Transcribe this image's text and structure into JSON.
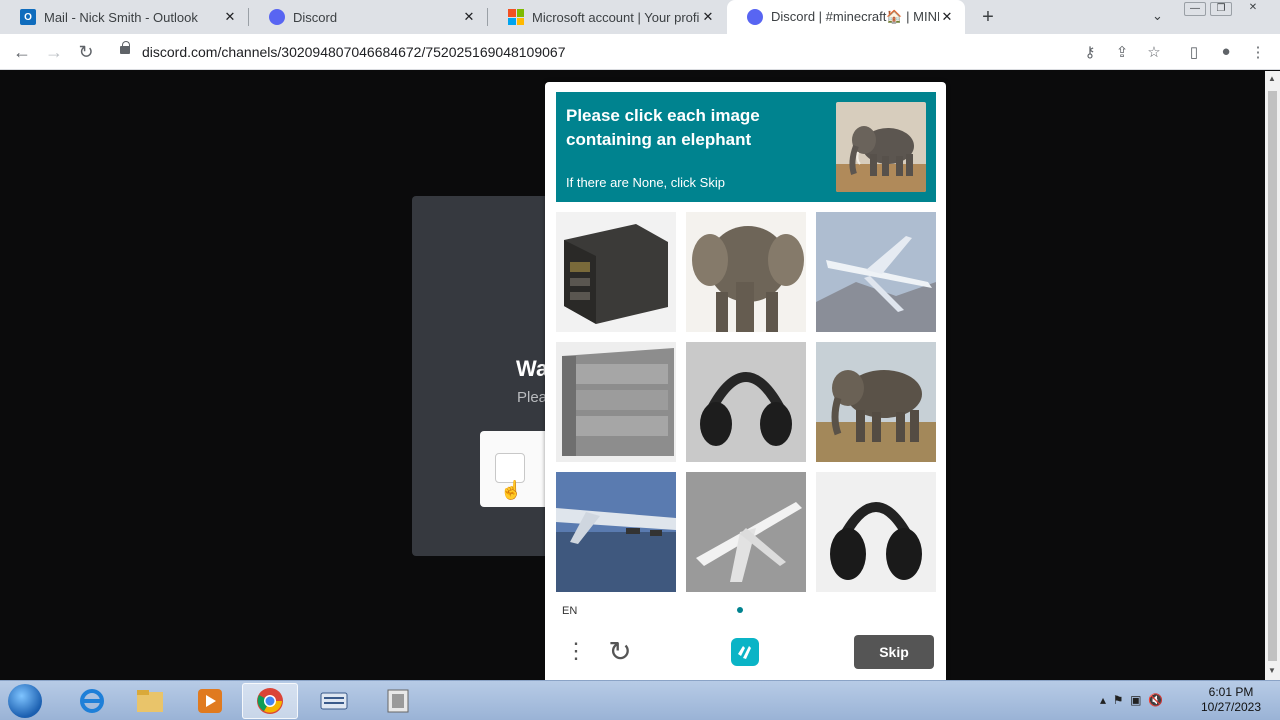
{
  "browser": {
    "tabs": [
      {
        "title": "Mail - Nick Smith - Outlook",
        "favicon": "outlook-icon"
      },
      {
        "title": "Discord",
        "favicon": "discord-icon"
      },
      {
        "title": "Microsoft account | Your profile",
        "favicon": "microsoft-icon"
      },
      {
        "title": "Discord | #minecraft🏠 | MINECR...",
        "favicon": "discord-icon",
        "active": true
      }
    ],
    "url": "discord.com/channels/302094807046684672/752025169048109067"
  },
  "discord_modal": {
    "heading": "Wa",
    "subtext": "Plea"
  },
  "captcha": {
    "prompt": "Please click each image containing an elephant",
    "hint": "If there are None, click Skip",
    "example_image": "elephant",
    "tiles": [
      "server-rack",
      "elephant",
      "airplane",
      "metal-cabinet",
      "headphones",
      "elephant",
      "airplane",
      "airplane",
      "headphones"
    ],
    "language": "EN",
    "skip_label": "Skip",
    "accent_color": "#00838f"
  },
  "taskbar": {
    "time": "6:01 PM",
    "date": "10/27/2023"
  }
}
